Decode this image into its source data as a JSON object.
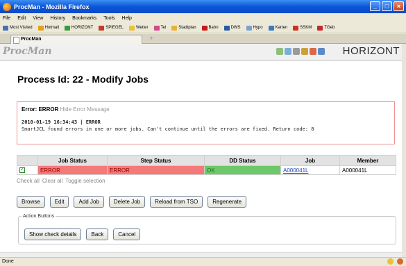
{
  "window": {
    "title": "ProcMan - Mozilla Firefox"
  },
  "menu": [
    "File",
    "Edit",
    "View",
    "History",
    "Bookmarks",
    "Tools",
    "Help"
  ],
  "bookmarks": [
    {
      "label": "Most Visited",
      "color": "#4a6fb5"
    },
    {
      "label": "Hotmail",
      "color": "#e3a21a"
    },
    {
      "label": "HORIZONT",
      "color": "#3a9a3a"
    },
    {
      "label": "SPIEGEL",
      "color": "#c43a2a"
    },
    {
      "label": "Wetter",
      "color": "#e8c23a"
    },
    {
      "label": "Tel",
      "color": "#d24a8a"
    },
    {
      "label": "Stadtplan",
      "color": "#e8b23a"
    },
    {
      "label": "Bahn",
      "color": "#c41a1a"
    },
    {
      "label": "DWS",
      "color": "#2a5aa5"
    },
    {
      "label": "Hypo",
      "color": "#7aa0d0"
    },
    {
      "label": "Karten",
      "color": "#3a7ac5"
    },
    {
      "label": "SSKM",
      "color": "#d4301a"
    },
    {
      "label": "TGeb",
      "color": "#c42a2a"
    }
  ],
  "tab": {
    "label": "ProcMan",
    "new_tab": "+"
  },
  "header": {
    "brand": "ProcMan",
    "company": "HORIZONT"
  },
  "page": {
    "title": "Process Id: 22 - Modify Jobs"
  },
  "error": {
    "label": "Error: ERROR",
    "hide_link": "Hide Error Message",
    "timestamp_line": "2010-01-19 16:34:43 | ERROR",
    "message": "SmartJCL found errors in one or more jobs. Can't continue until the errors are fixed. Return code: 8"
  },
  "table": {
    "headers": [
      "Job Status",
      "Step Status",
      "DD Status",
      "Job",
      "Member"
    ],
    "rows": [
      {
        "checked": true,
        "job_status": "ERROR",
        "step_status": "ERROR",
        "dd_status": "OK",
        "job": "A000041L",
        "member": "A000041L"
      }
    ]
  },
  "selection": {
    "check_all": "Check all",
    "clear_all": "Clear all",
    "toggle": "Toggle selection"
  },
  "buttons": {
    "browse": "Browse",
    "edit": "Edit",
    "add_job": "Add Job",
    "delete_job": "Delete Job",
    "reload": "Reload from TSO",
    "regenerate": "Regenerate"
  },
  "action_buttons": {
    "legend": "Action Buttons",
    "show_check": "Show check details",
    "back": "Back",
    "cancel": "Cancel"
  },
  "status": {
    "text": "Done"
  },
  "colors": {
    "error_row": "#f47a7a",
    "ok_cell": "#6ec86a",
    "title_bar": "#0b56d8"
  }
}
